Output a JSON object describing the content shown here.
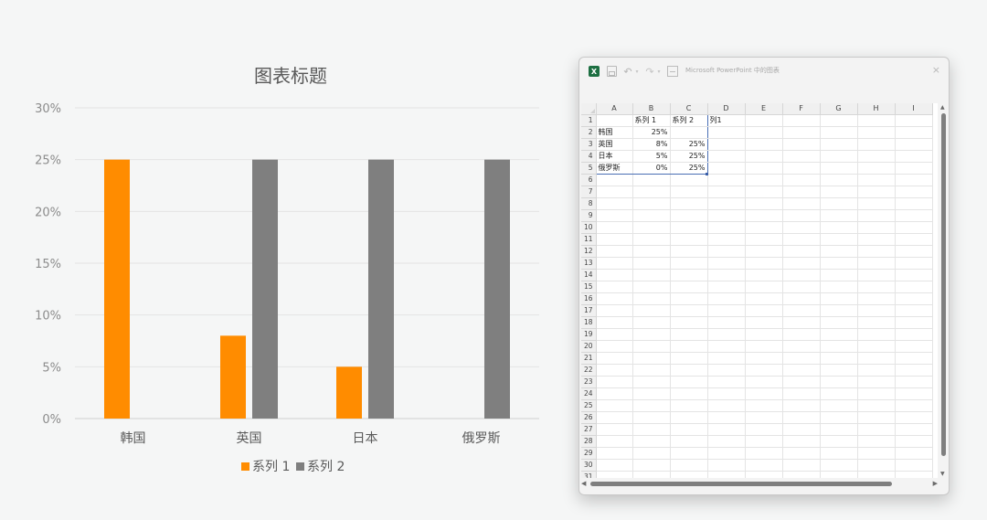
{
  "chart_data": {
    "type": "bar",
    "title": "图表标题",
    "categories": [
      "韩国",
      "英国",
      "日本",
      "俄罗斯"
    ],
    "series": [
      {
        "name": "系列 1",
        "color": "#ff8c00",
        "values": [
          25,
          8,
          5,
          0
        ]
      },
      {
        "name": "系列 2",
        "color": "#7f7f7f",
        "values": [
          null,
          25,
          25,
          25
        ]
      }
    ],
    "y_ticks": [
      "0%",
      "5%",
      "10%",
      "15%",
      "20%",
      "25%",
      "30%"
    ],
    "ylim": [
      0,
      30
    ],
    "y_unit": "%",
    "grid": true,
    "legend_position": "bottom"
  },
  "excel": {
    "window_title": "Microsoft PowerPoint 中的图表",
    "logo_glyph": "X",
    "undo_glyph": "↶",
    "redo_glyph": "↷",
    "dropdown_glyph": "▾",
    "close_glyph": "×",
    "scroll_up_glyph": "▲",
    "scroll_down_glyph": "▼",
    "scroll_left_glyph": "◀",
    "scroll_right_glyph": "▶",
    "icons": [
      "excel-logo-icon",
      "save-icon",
      "undo-icon",
      "redo-icon",
      "edit-data-sheet-icon",
      "close-icon"
    ],
    "columns": [
      "A",
      "B",
      "C",
      "D",
      "E",
      "F",
      "G",
      "H",
      "I"
    ],
    "row_count": 31,
    "cells": [
      [
        "",
        "系列 1",
        "系列 2",
        "列1"
      ],
      [
        "韩国",
        "25%",
        "",
        ""
      ],
      [
        "英国",
        "8%",
        "25%",
        ""
      ],
      [
        "日本",
        "5%",
        "25%",
        ""
      ],
      [
        "俄罗斯",
        "0%",
        "25%",
        ""
      ]
    ]
  }
}
